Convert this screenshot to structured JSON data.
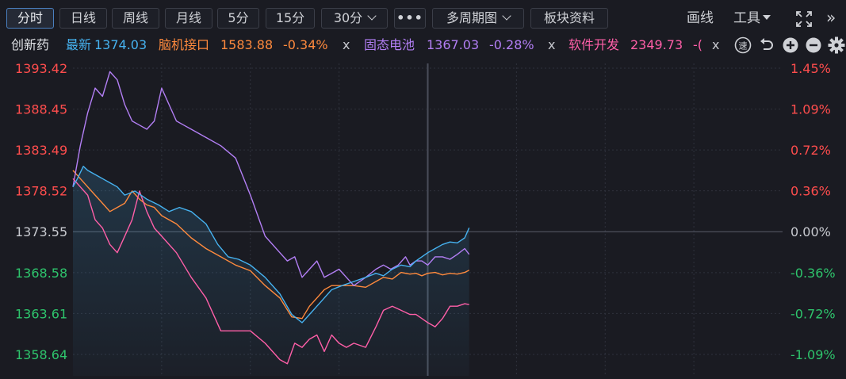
{
  "toolbar": {
    "buttons": [
      {
        "label": "分时",
        "active": true
      },
      {
        "label": "日线"
      },
      {
        "label": "周线"
      },
      {
        "label": "月线"
      },
      {
        "label": "5分"
      },
      {
        "label": "15分"
      },
      {
        "label": "30分",
        "dropdown": true
      },
      {
        "label": "•••"
      },
      {
        "label": "多周期图",
        "dropdown": true
      },
      {
        "label": "板块资料"
      }
    ],
    "draw_label": "画线",
    "tools_label": "工具",
    "expand_icon": "expand-icon",
    "collapse_icon": "double-chevron-right-icon"
  },
  "legend": {
    "name": "创新药",
    "latest_label": "最新",
    "latest_value": "1374.03",
    "items": [
      {
        "name": "脑机接口",
        "value": "1583.88",
        "change": "-0.34%",
        "color": "#ff8a3d"
      },
      {
        "name": "固态电池",
        "value": "1367.03",
        "change": "-0.28%",
        "color": "#b37ff5"
      },
      {
        "name": "软件开发",
        "value": "2349.73",
        "change": "-(",
        "color": "#ff5fa8"
      }
    ],
    "remove_symbol": "x",
    "icons": [
      "speed-icon",
      "undo-icon",
      "zoom-in-icon",
      "zoom-out-icon",
      "settings-gear-icon"
    ]
  },
  "colors": {
    "background": "#1a1b22",
    "up": "#ff4d4d",
    "down": "#2ec46c",
    "neutral": "#c8cad0",
    "main": "#46b2f0"
  },
  "chart_data": {
    "type": "line",
    "y_ticks": [
      "1393.42",
      "1388.45",
      "1383.49",
      "1378.52",
      "1373.55",
      "1368.58",
      "1363.61",
      "1358.64"
    ],
    "y_pct_ticks": [
      "1.45%",
      "1.09%",
      "0.72%",
      "0.36%",
      "0.00%",
      "-0.36%",
      "-0.72%",
      "-1.09%"
    ],
    "base_price": 1373.55,
    "ylim": [
      1356.5,
      1395.5
    ],
    "x_session_minutes": 240,
    "grid": true,
    "series": [
      {
        "name": "创新药",
        "color": "#46b2f0",
        "fill": true,
        "x": [
          0,
          3,
          7,
          10,
          15,
          20,
          25,
          30,
          35,
          42,
          50,
          58,
          65,
          72,
          80,
          90,
          98,
          105,
          112,
          120,
          130,
          140,
          148,
          155,
          160,
          165,
          170,
          175,
          182,
          190,
          198,
          205,
          210,
          216,
          222,
          228,
          232,
          236,
          240,
          245,
          250,
          255,
          260,
          265,
          268
        ],
        "y": [
          1379,
          1380,
          1381.5,
          1381,
          1380.5,
          1380,
          1379.5,
          1379,
          1378,
          1378.5,
          1377.5,
          1376.8,
          1376,
          1376.5,
          1376,
          1374.5,
          1372,
          1370.5,
          1370.2,
          1369.5,
          1368,
          1366,
          1363.5,
          1362.5,
          1363.5,
          1364.5,
          1365.5,
          1366.5,
          1367,
          1367.5,
          1368,
          1368.5,
          1368.2,
          1369,
          1369.5,
          1369.3,
          1370,
          1370.5,
          1371,
          1371.5,
          1372,
          1372.3,
          1372.2,
          1372.8,
          1374.03
        ]
      },
      {
        "name": "脑机接口",
        "color": "#ff8a3d",
        "x": [
          0,
          5,
          10,
          15,
          20,
          25,
          30,
          35,
          40,
          45,
          50,
          55,
          60,
          70,
          80,
          90,
          100,
          110,
          120,
          130,
          140,
          148,
          155,
          160,
          165,
          170,
          175,
          182,
          190,
          198,
          205,
          210,
          216,
          222,
          228,
          232,
          236,
          240,
          245,
          250,
          255,
          260,
          265,
          268
        ],
        "y": [
          1381,
          1380,
          1379,
          1378,
          1377,
          1376,
          1376.5,
          1377,
          1378.5,
          1377.5,
          1376.8,
          1376.5,
          1375.5,
          1374.5,
          1372.8,
          1371.5,
          1370.5,
          1369.5,
          1368.8,
          1367,
          1365.5,
          1363.2,
          1363,
          1364.5,
          1365.5,
          1366.5,
          1367,
          1367,
          1367,
          1366.8,
          1367.5,
          1368,
          1367.8,
          1368.6,
          1368.4,
          1368.5,
          1368.2,
          1368.5,
          1368.6,
          1368.3,
          1368.5,
          1368.4,
          1368.6,
          1368.88
        ]
      },
      {
        "name": "固态电池",
        "color": "#b37ff5",
        "x": [
          0,
          5,
          10,
          15,
          20,
          25,
          30,
          35,
          40,
          45,
          50,
          55,
          60,
          65,
          70,
          75,
          80,
          90,
          100,
          110,
          120,
          130,
          140,
          145,
          150,
          155,
          160,
          165,
          170,
          175,
          180,
          185,
          190,
          198,
          205,
          210,
          215,
          220,
          225,
          228,
          232,
          236,
          240,
          245,
          250,
          255,
          260,
          265,
          268
        ],
        "y": [
          1379,
          1384,
          1388,
          1391,
          1390,
          1393,
          1392,
          1389,
          1387,
          1386.5,
          1386,
          1387,
          1391,
          1389,
          1387,
          1386.5,
          1386,
          1385,
          1384,
          1382.5,
          1378,
          1373,
          1371,
          1370,
          1370.5,
          1368,
          1369,
          1370,
          1368,
          1368.5,
          1369,
          1368,
          1367,
          1368,
          1369,
          1369.5,
          1369,
          1369.5,
          1370.5,
          1369.5,
          1370,
          1370,
          1369.5,
          1370.5,
          1370.5,
          1370.2,
          1370.8,
          1371.5,
          1370.8
        ]
      },
      {
        "name": "软件开发",
        "color": "#ff5fa8",
        "x": [
          0,
          5,
          10,
          15,
          20,
          25,
          30,
          35,
          40,
          45,
          50,
          55,
          60,
          70,
          80,
          90,
          100,
          110,
          120,
          130,
          140,
          145,
          150,
          155,
          160,
          165,
          170,
          175,
          180,
          185,
          190,
          198,
          205,
          210,
          216,
          222,
          228,
          232,
          236,
          240,
          245,
          250,
          255,
          260,
          265,
          268
        ],
        "y": [
          1380,
          1379,
          1378,
          1375,
          1374,
          1372,
          1371,
          1373,
          1375,
          1378.5,
          1376,
          1374,
          1373,
          1371,
          1368,
          1365.5,
          1361.5,
          1361.5,
          1361.5,
          1360,
          1358,
          1357.5,
          1360,
          1359.5,
          1360.5,
          1361,
          1359,
          1361,
          1360,
          1359.5,
          1360,
          1359.5,
          1362,
          1364,
          1364.5,
          1364,
          1363.5,
          1363.5,
          1363,
          1362.5,
          1362,
          1363,
          1364.5,
          1364.5,
          1364.8,
          1364.7
        ]
      }
    ]
  }
}
